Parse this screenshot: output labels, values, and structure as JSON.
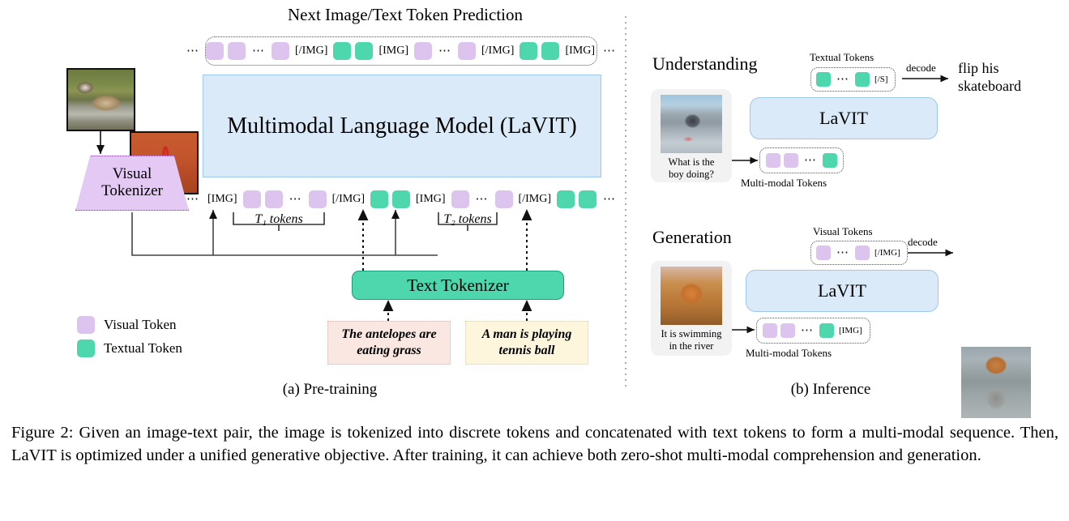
{
  "figure": {
    "pretraining_title": "Next Image/Text Token Prediction",
    "llm_label": "Multimodal Language Model (LaVIT)",
    "visual_tokenizer_line1": "Visual",
    "visual_tokenizer_line2": "Tokenizer",
    "text_tokenizer": "Text Tokenizer",
    "bracket_label_1": "T₁ tokens",
    "bracket_label_2": "T₂ tokens",
    "caption_left": "The antelopes are eating grass",
    "caption_right": "A man is playing tennis ball",
    "legend": [
      {
        "label": "Visual Token",
        "color": "#ddc4ee",
        "kind": "visual"
      },
      {
        "label": "Textual Token",
        "color": "#4ed6ad",
        "kind": "textual"
      }
    ],
    "subcaption_a": "(a) Pre-training",
    "subcaption_b": "(b) Inference"
  },
  "top_token_row": [
    {
      "type": "dots",
      "text": "⋯"
    },
    {
      "type": "visual"
    },
    {
      "type": "visual"
    },
    {
      "type": "dots",
      "text": "⋯"
    },
    {
      "type": "visual"
    },
    {
      "type": "marker",
      "text": "[/IMG]"
    },
    {
      "type": "textual"
    },
    {
      "type": "textual"
    },
    {
      "type": "marker",
      "text": "[IMG]"
    },
    {
      "type": "visual"
    },
    {
      "type": "dots",
      "text": "⋯"
    },
    {
      "type": "visual"
    },
    {
      "type": "marker",
      "text": "[/IMG]"
    },
    {
      "type": "textual"
    },
    {
      "type": "textual"
    },
    {
      "type": "marker",
      "text": "[IMG]"
    },
    {
      "type": "dots",
      "text": "⋯"
    }
  ],
  "bottom_token_row": [
    {
      "type": "dots",
      "text": "⋯"
    },
    {
      "type": "marker",
      "text": "[IMG]"
    },
    {
      "type": "visual"
    },
    {
      "type": "visual"
    },
    {
      "type": "dots",
      "text": "⋯"
    },
    {
      "type": "visual"
    },
    {
      "type": "marker",
      "text": "[/IMG]"
    },
    {
      "type": "textual"
    },
    {
      "type": "textual"
    },
    {
      "type": "marker",
      "text": "[IMG]"
    },
    {
      "type": "visual"
    },
    {
      "type": "dots",
      "text": "⋯"
    },
    {
      "type": "visual"
    },
    {
      "type": "marker",
      "text": "[/IMG]"
    },
    {
      "type": "textual"
    },
    {
      "type": "textual"
    },
    {
      "type": "dots",
      "text": "⋯"
    }
  ],
  "inference": {
    "understanding": {
      "heading": "Understanding",
      "input_caption_line1": "What is the",
      "input_caption_line2": "boy doing?",
      "input_photo": "skateboarder-photo",
      "multimodal_label": "Multi-modal Tokens",
      "multimodal_tokens": [
        {
          "type": "visual"
        },
        {
          "type": "visual"
        },
        {
          "type": "dots",
          "text": "⋯"
        },
        {
          "type": "textual"
        }
      ],
      "model_label": "LaVIT",
      "output_tokens_label": "Textual Tokens",
      "output_tokens": [
        {
          "type": "textual"
        },
        {
          "type": "dots",
          "text": "⋯"
        },
        {
          "type": "textual"
        },
        {
          "type": "marker",
          "text": "[/S]"
        }
      ],
      "decode_label": "decode",
      "result_line1": "flip his",
      "result_line2": "skateboard"
    },
    "generation": {
      "heading": "Generation",
      "input_caption_line1": "It is swimming",
      "input_caption_line2": "in the river",
      "input_photo": "orange-cat-photo",
      "multimodal_label": "Multi-modal Tokens",
      "multimodal_tokens": [
        {
          "type": "visual"
        },
        {
          "type": "visual"
        },
        {
          "type": "dots",
          "text": "⋯"
        },
        {
          "type": "textual"
        },
        {
          "type": "marker",
          "text": "[IMG]"
        }
      ],
      "model_label": "LaVIT",
      "output_tokens_label": "Visual Tokens",
      "output_tokens": [
        {
          "type": "visual"
        },
        {
          "type": "dots",
          "text": "⋯"
        },
        {
          "type": "visual"
        },
        {
          "type": "marker",
          "text": "[/IMG]"
        }
      ],
      "decode_label": "decode",
      "result_photo": "cat-in-water-photo"
    }
  },
  "source_images": [
    {
      "name": "antelope-photo"
    },
    {
      "name": "tennis-photo"
    }
  ],
  "caption": {
    "text": "Figure 2: Given an image-text pair, the image is tokenized into discrete tokens and concatenated with text tokens to form a multi-modal sequence.  Then, LaVIT is optimized under a unified generative objective. After training, it can achieve both zero-shot multi-modal comprehension and generation."
  },
  "colors": {
    "visual_token": "#ddc4ee",
    "textual_token": "#4ed6ad",
    "llm_box_fill": "#daeaf8",
    "llm_box_border": "#9dc8e8",
    "visual_tokenizer_fill": "#e4c9f4",
    "visual_tokenizer_border": "#7c3fa8",
    "caption_left_fill": "#fbe7e2",
    "caption_right_fill": "#fdf6dd"
  }
}
